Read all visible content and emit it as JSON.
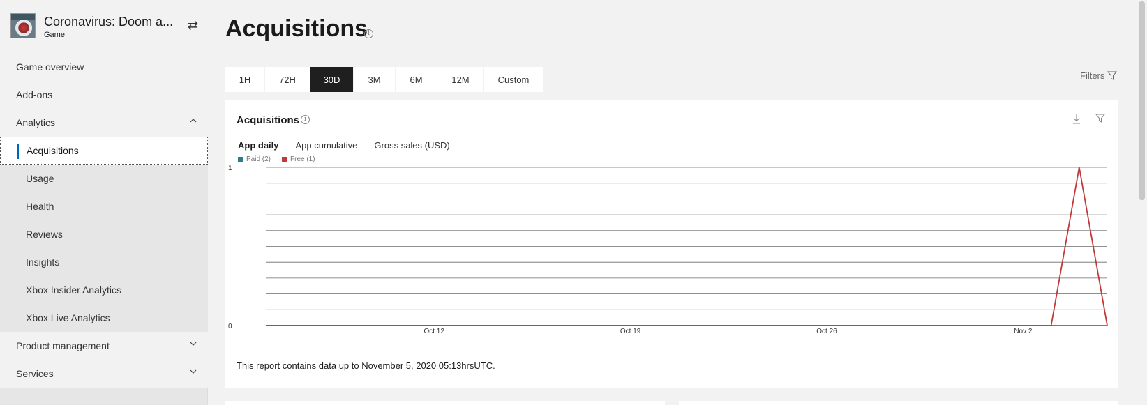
{
  "app": {
    "title": "Coronavirus: Doom a...",
    "subtitle": "Game",
    "swap_icon": "swap-arrows-icon"
  },
  "sidebar": {
    "items": [
      {
        "label": "Game overview",
        "level": "top"
      },
      {
        "label": "Add-ons",
        "level": "top"
      },
      {
        "label": "Analytics",
        "level": "top",
        "expanded": true
      },
      {
        "label": "Acquisitions",
        "level": "sub",
        "selected": true
      },
      {
        "label": "Usage",
        "level": "sub"
      },
      {
        "label": "Health",
        "level": "sub"
      },
      {
        "label": "Reviews",
        "level": "sub"
      },
      {
        "label": "Insights",
        "level": "sub"
      },
      {
        "label": "Xbox Insider Analytics",
        "level": "sub"
      },
      {
        "label": "Xbox Live Analytics",
        "level": "sub"
      },
      {
        "label": "Product management",
        "level": "top",
        "expanded": false
      },
      {
        "label": "Services",
        "level": "top",
        "expanded": false
      }
    ]
  },
  "page": {
    "title": "Acquisitions",
    "info_symbol": "i"
  },
  "range_tabs": {
    "items": [
      "1H",
      "72H",
      "30D",
      "3M",
      "6M",
      "12M",
      "Custom"
    ],
    "active": "30D"
  },
  "filters": {
    "label": "Filters"
  },
  "card": {
    "title": "Acquisitions",
    "subtabs": [
      "App daily",
      "App cumulative",
      "Gross sales (USD)"
    ],
    "active_subtab": "App daily",
    "legend": [
      {
        "label": "Paid (2)",
        "color": "#2e7d8c"
      },
      {
        "label": "Free (1)",
        "color": "#c0393b"
      }
    ],
    "note": "This report contains data up to November 5, 2020 05:13hrsUTC."
  },
  "chart_data": {
    "type": "line",
    "x": [
      "2020-10-06",
      "2020-10-07",
      "2020-10-08",
      "2020-10-09",
      "2020-10-10",
      "2020-10-11",
      "2020-10-12",
      "2020-10-13",
      "2020-10-14",
      "2020-10-15",
      "2020-10-16",
      "2020-10-17",
      "2020-10-18",
      "2020-10-19",
      "2020-10-20",
      "2020-10-21",
      "2020-10-22",
      "2020-10-23",
      "2020-10-24",
      "2020-10-25",
      "2020-10-26",
      "2020-10-27",
      "2020-10-28",
      "2020-10-29",
      "2020-10-30",
      "2020-10-31",
      "2020-11-01",
      "2020-11-02",
      "2020-11-03",
      "2020-11-04",
      "2020-11-05"
    ],
    "series": [
      {
        "name": "Paid (2)",
        "color": "#2e7d8c",
        "values": [
          0,
          0,
          0,
          0,
          0,
          0,
          0,
          0,
          0,
          0,
          0,
          0,
          0,
          0,
          0,
          0,
          0,
          0,
          0,
          0,
          0,
          0,
          0,
          0,
          0,
          0,
          0,
          0,
          0,
          0,
          0
        ]
      },
      {
        "name": "Free (1)",
        "color": "#c0393b",
        "values": [
          0,
          0,
          0,
          0,
          0,
          0,
          0,
          0,
          0,
          0,
          0,
          0,
          0,
          0,
          0,
          0,
          0,
          0,
          0,
          0,
          0,
          0,
          0,
          0,
          0,
          0,
          0,
          0,
          0,
          1,
          0
        ]
      }
    ],
    "xticks": [
      "Oct 12",
      "Oct 19",
      "Oct 26",
      "Nov 2"
    ],
    "xtick_dates": [
      "2020-10-12",
      "2020-10-19",
      "2020-10-26",
      "2020-11-02"
    ],
    "ylim": [
      0,
      1
    ],
    "yticks": [
      "0",
      "1"
    ],
    "grid": true,
    "legend_position": "top-left"
  }
}
